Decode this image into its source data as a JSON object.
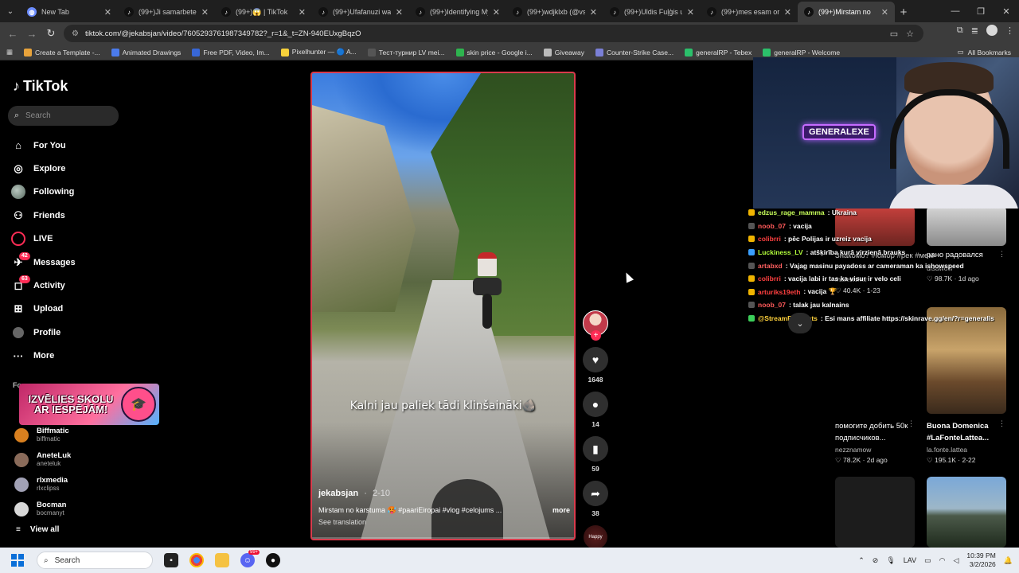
{
  "browser": {
    "tabs": [
      {
        "title": "New Tab",
        "icon": "globe-icon",
        "active": false
      },
      {
        "title": "(99+)Ji samarbete me",
        "icon": "tiktok-icon",
        "active": false
      },
      {
        "title": "(99+)😱 | TikTok",
        "icon": "tiktok-icon",
        "active": false
      },
      {
        "title": "(99+)Ufafanuzi wa Pe",
        "icon": "tiktok-icon",
        "active": false
      },
      {
        "title": "(99+)Identifying Mys",
        "icon": "tiktok-icon",
        "active": false
      },
      {
        "title": "(99+)wdjklxb (@vsd",
        "icon": "tiktok-icon",
        "active": false
      },
      {
        "title": "(99+)Uldis Fuļģis un",
        "icon": "tiktok-icon",
        "active": false
      },
      {
        "title": "(99+)mes esam origi",
        "icon": "tiktok-icon",
        "active": false
      },
      {
        "title": "(99+)Mirstam no",
        "icon": "tiktok-icon",
        "active": true
      }
    ],
    "url": "tiktok.com/@jekabsjan/video/7605293761987349782?_r=1&_t=ZN-940EUxgBqzO",
    "bookmarks": [
      {
        "label": "Create a Template -...",
        "color": "#e8a33b"
      },
      {
        "label": "Animated Drawings",
        "color": "#4b7bec"
      },
      {
        "label": "Free PDF, Video, Im...",
        "color": "#3867d6"
      },
      {
        "label": "Pixelhunter — 🔵 A...",
        "color": "#f7d13b"
      },
      {
        "label": "Тест-турнир LV mei...",
        "color": "#555555"
      },
      {
        "label": "skin price - Google i...",
        "color": "#2eb44f"
      },
      {
        "label": "Giveaway",
        "color": "#bbbbbb"
      },
      {
        "label": "Counter-Strike Case...",
        "color": "#7a7fd6"
      },
      {
        "label": "generalRP - Tebex",
        "color": "#2bc06b"
      },
      {
        "label": "generalRP - Welcome",
        "color": "#2bc06b"
      }
    ],
    "all_bookmarks": "All Bookmarks"
  },
  "tiktok": {
    "logo": "TikTok",
    "search_placeholder": "Search",
    "menu": [
      {
        "label": "For You",
        "icon": "home-icon"
      },
      {
        "label": "Explore",
        "icon": "compass-icon"
      },
      {
        "label": "Following",
        "icon": "avatar-icon"
      },
      {
        "label": "Friends",
        "icon": "friends-icon"
      },
      {
        "label": "LIVE",
        "icon": "live-icon"
      },
      {
        "label": "Messages",
        "icon": "messages-icon",
        "badge": "42"
      },
      {
        "label": "Activity",
        "icon": "activity-icon",
        "badge": "63"
      },
      {
        "label": "Upload",
        "icon": "upload-icon"
      },
      {
        "label": "Profile",
        "icon": "profile-icon"
      },
      {
        "label": "More",
        "icon": "more-icon"
      }
    ],
    "following_label": "Fo",
    "promo_text": "IZVĒLIES SKOLU AR IESPĒJĀM!",
    "following_accounts": [
      {
        "name": "Biffmatic",
        "handle": "biffmatic",
        "color": "#d9801f"
      },
      {
        "name": "AneteLuk",
        "handle": "aneteluk",
        "color": "#8a6b5a"
      },
      {
        "name": "rlxmedia",
        "handle": "rlxclipss",
        "color": "#a1a1b5"
      },
      {
        "name": "Bocman",
        "handle": "bocmanyt",
        "color": "#d8d8d8"
      }
    ],
    "view_all": "View all"
  },
  "video": {
    "caption_overlay": "Kalni jau paliek tādi klinšaināki🪨",
    "author": "jekabsjan",
    "date": "2-10",
    "description": "Mirstam no karstuma 🥵 #paariEiropai #vlog #celojums ...",
    "more": "more",
    "see_translation": "See translation",
    "progress": 0.0
  },
  "actions": {
    "likes": "1648",
    "comments": "14",
    "saves": "59",
    "shares": "38",
    "music_label": "Happy"
  },
  "stream": {
    "neon_sign": "GENERALEXE",
    "chat": [
      {
        "user": "edzus_rage_mamma",
        "msg": ": Ukraina",
        "color": "#c8ff5a",
        "badge": "#f0b400"
      },
      {
        "user": "noob_07",
        "msg": ": vacija",
        "color": "#ff5a5a",
        "badge": "#555555"
      },
      {
        "user": "colibrri",
        "msg": ": pēc Polijas ir uzreiz vacija",
        "color": "#ff4040",
        "badge": "#f0b400"
      },
      {
        "user": "Luckiness_LV",
        "msg": ": atšķirība kurā virzienā brauks",
        "color": "#b4ff3c",
        "badge": "#3aa0ff"
      },
      {
        "user": "artabxd",
        "msg": ": Vajag masinu payadoss ar cameraman ka ishowspeed",
        "color": "#ff6060",
        "badge": "#555555"
      },
      {
        "user": "colibrri",
        "msg": ": vacija labi ir tas ka visur ir velo celi",
        "color": "#ff4040",
        "badge": "#f0b400"
      },
      {
        "user": "arturiks19eth",
        "msg": ": vacija 🏆",
        "color": "#ff4040",
        "badge": "#f0b400"
      },
      {
        "user": "noob_07",
        "msg": ": talak jau kalnains",
        "color": "#ff5a5a",
        "badge": "#555555"
      },
      {
        "user": "@StreamElements",
        "msg": ": Esi mans affiliate https://skinrave.gg/en/?r=generalis",
        "color": "#ffd23c",
        "badge": "#3ccf5a"
      }
    ]
  },
  "grid": {
    "items": [
      {
        "title": "рано радовался",
        "author": "disawow",
        "likes": "98.7K",
        "age": "1d ago"
      },
      {
        "title": "Знакомо? #юмор #рек #мем",
        "author": "malewsker",
        "likes": "40.4K",
        "age": "1-23"
      },
      {
        "title": "помогите добить 50к подписчиков...",
        "author": "nezznamow",
        "likes": "78.2K",
        "age": "2d ago"
      },
      {
        "title": "Buona Domenica #LaFonteLattea...",
        "author": "la.fonte.lattea",
        "likes": "195.1K",
        "age": "2-22"
      }
    ]
  },
  "taskbar": {
    "search_placeholder": "Search",
    "lang": "LAV",
    "time": "10:39 PM",
    "date": "3/2/2026",
    "discord_badge": "99+"
  }
}
